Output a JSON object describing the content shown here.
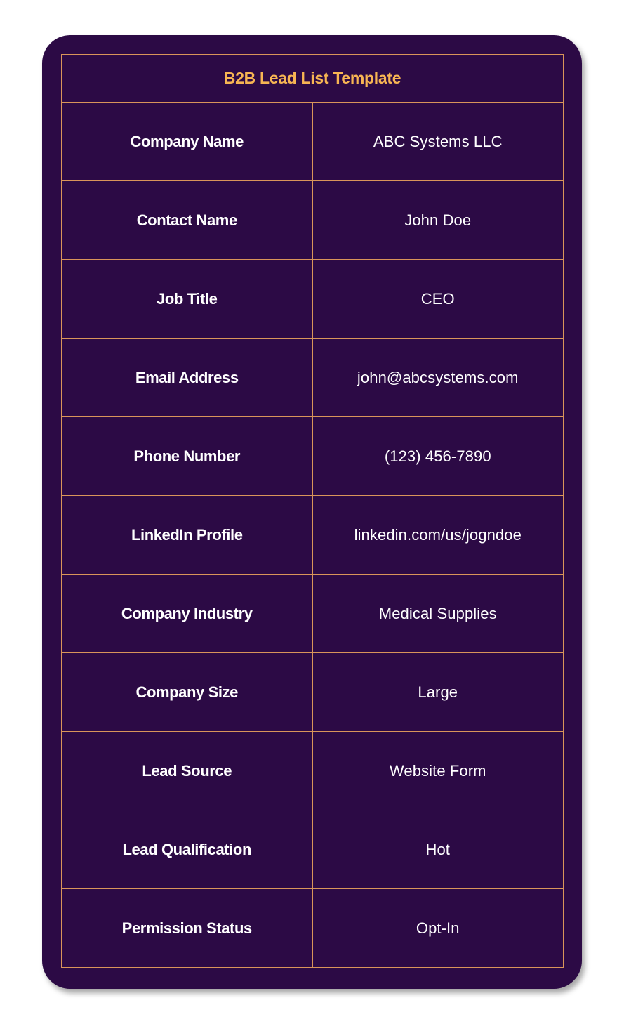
{
  "title": "B2B Lead List Template",
  "colors": {
    "background": "#2c0a45",
    "border": "#d9955a",
    "title": "#f7b553",
    "text": "#ffffff"
  },
  "rows": [
    {
      "label": "Company Name",
      "value": "ABC Systems LLC"
    },
    {
      "label": "Contact Name",
      "value": "John Doe"
    },
    {
      "label": "Job Title",
      "value": "CEO"
    },
    {
      "label": "Email Address",
      "value": "john@abcsystems.com"
    },
    {
      "label": "Phone Number",
      "value": "(123) 456-7890"
    },
    {
      "label": "LinkedIn Profile",
      "value": "linkedin.com/us/jogndoe"
    },
    {
      "label": "Company Industry",
      "value": "Medical Supplies"
    },
    {
      "label": "Company Size",
      "value": "Large"
    },
    {
      "label": "Lead Source",
      "value": "Website Form"
    },
    {
      "label": "Lead Qualification",
      "value": "Hot"
    },
    {
      "label": "Permission Status",
      "value": "Opt-In"
    }
  ]
}
